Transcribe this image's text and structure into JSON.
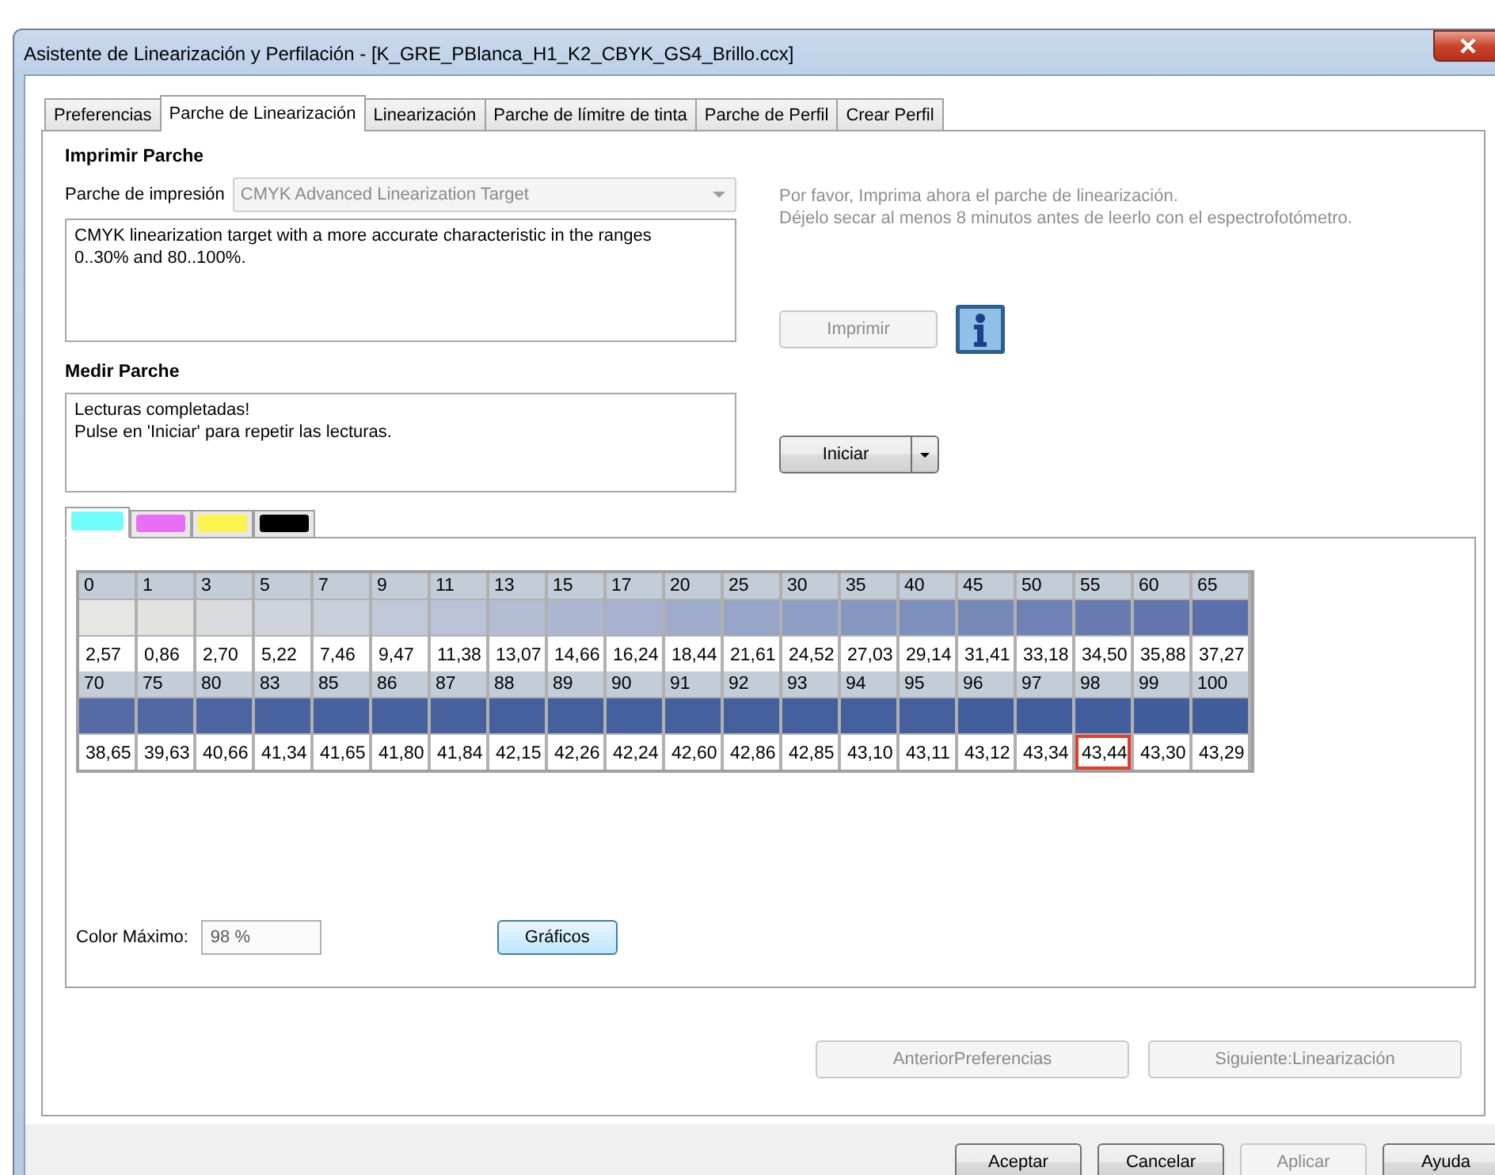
{
  "window": {
    "title": "Asistente de Linearización y Perfilación - [K_GRE_PBlanca_H1_K2_CBYK_GS4_Brillo.ccx]"
  },
  "tabs": [
    {
      "label": "Preferencias",
      "selected": false
    },
    {
      "label": "Parche de Linearización",
      "selected": true
    },
    {
      "label": "Linearización",
      "selected": false
    },
    {
      "label": "Parche de límitre de tinta",
      "selected": false
    },
    {
      "label": "Parche de Perfil",
      "selected": false
    },
    {
      "label": "Crear Perfil",
      "selected": false
    }
  ],
  "print_section": {
    "heading": "Imprimir Parche",
    "target_label": "Parche de impresión",
    "target_value": "CMYK Advanced Linearization Target",
    "target_disabled": true,
    "description": "CMYK linearization target with a more accurate characteristic in the ranges\n0..30% and 80..100%.",
    "instructions": "Por favor, Imprima ahora el parche de linearización.\nDéjelo secar al menos 8 minutos antes de leerlo con el espectrofotómetro.",
    "print_button": {
      "label": "Imprimir",
      "disabled": true
    }
  },
  "measure_section": {
    "heading": "Medir Parche",
    "status": "Lecturas completadas!\nPulse en 'Iniciar' para repetir las lecturas.",
    "start_button": {
      "label": "Iniciar"
    }
  },
  "ink_tabs": [
    {
      "color": "#6ffcfc",
      "selected": true
    },
    {
      "color": "#e76ef5",
      "selected": false
    },
    {
      "color": "#fff34f",
      "selected": false
    },
    {
      "color": "#000000",
      "selected": false
    }
  ],
  "patch_rows": [
    [
      {
        "label": "0",
        "color": "#e6e6e2",
        "value": "2,57",
        "selected": false
      },
      {
        "label": "1",
        "color": "#e2e2df",
        "value": "0,86",
        "selected": false
      },
      {
        "label": "3",
        "color": "#d8dade",
        "value": "2,70",
        "selected": false
      },
      {
        "label": "5",
        "color": "#cfd3dc",
        "value": "5,22",
        "selected": false
      },
      {
        "label": "7",
        "color": "#c8ceda",
        "value": "7,46",
        "selected": false
      },
      {
        "label": "9",
        "color": "#c0c7d8",
        "value": "9,47",
        "selected": false
      },
      {
        "label": "11",
        "color": "#b9c2d6",
        "value": "11,38",
        "selected": false
      },
      {
        "label": "13",
        "color": "#b3bdd4",
        "value": "13,07",
        "selected": false
      },
      {
        "label": "15",
        "color": "#acb7d2",
        "value": "14,66",
        "selected": false
      },
      {
        "label": "17",
        "color": "#a6b2cf",
        "value": "16,24",
        "selected": false
      },
      {
        "label": "20",
        "color": "#9eabcb",
        "value": "18,44",
        "selected": false
      },
      {
        "label": "25",
        "color": "#96a4c8",
        "value": "21,61",
        "selected": false
      },
      {
        "label": "30",
        "color": "#8e9dc4",
        "value": "24,52",
        "selected": false
      },
      {
        "label": "35",
        "color": "#8596c0",
        "value": "27,03",
        "selected": false
      },
      {
        "label": "40",
        "color": "#7d8fbc",
        "value": "29,14",
        "selected": false
      },
      {
        "label": "45",
        "color": "#7688b8",
        "value": "31,41",
        "selected": false
      },
      {
        "label": "50",
        "color": "#6f81b4",
        "value": "33,18",
        "selected": false
      },
      {
        "label": "55",
        "color": "#687bb1",
        "value": "34,50",
        "selected": false
      },
      {
        "label": "60",
        "color": "#6276ad",
        "value": "35,88",
        "selected": false
      },
      {
        "label": "65",
        "color": "#5b70aa",
        "value": "37,27",
        "selected": false
      }
    ],
    [
      {
        "label": "70",
        "color": "#556ba6",
        "value": "38,65",
        "selected": false
      },
      {
        "label": "75",
        "color": "#5068a4",
        "value": "39,63",
        "selected": false
      },
      {
        "label": "80",
        "color": "#4c65a2",
        "value": "40,66",
        "selected": false
      },
      {
        "label": "83",
        "color": "#4963a0",
        "value": "41,34",
        "selected": false
      },
      {
        "label": "85",
        "color": "#48629f",
        "value": "41,65",
        "selected": false
      },
      {
        "label": "86",
        "color": "#47619f",
        "value": "41,80",
        "selected": false
      },
      {
        "label": "87",
        "color": "#47619e",
        "value": "41,84",
        "selected": false
      },
      {
        "label": "88",
        "color": "#46609e",
        "value": "42,15",
        "selected": false
      },
      {
        "label": "89",
        "color": "#46609e",
        "value": "42,26",
        "selected": false
      },
      {
        "label": "90",
        "color": "#45609e",
        "value": "42,24",
        "selected": false
      },
      {
        "label": "91",
        "color": "#45609d",
        "value": "42,60",
        "selected": false
      },
      {
        "label": "92",
        "color": "#455f9d",
        "value": "42,86",
        "selected": false
      },
      {
        "label": "93",
        "color": "#445f9d",
        "value": "42,85",
        "selected": false
      },
      {
        "label": "94",
        "color": "#445f9d",
        "value": "43,10",
        "selected": false
      },
      {
        "label": "95",
        "color": "#445f9c",
        "value": "43,11",
        "selected": false
      },
      {
        "label": "96",
        "color": "#435e9c",
        "value": "43,12",
        "selected": false
      },
      {
        "label": "97",
        "color": "#435e9c",
        "value": "43,34",
        "selected": false
      },
      {
        "label": "98",
        "color": "#435e9c",
        "value": "43,44",
        "selected": true
      },
      {
        "label": "99",
        "color": "#425d9b",
        "value": "43,30",
        "selected": false
      },
      {
        "label": "100",
        "color": "#425d9b",
        "value": "43,29",
        "selected": false
      }
    ]
  ],
  "max_color": {
    "label": "Color Máximo:",
    "value": "98 %"
  },
  "graphs_button": {
    "label": "Gráficos"
  },
  "nav_buttons": [
    {
      "label": "AnteriorPreferencias",
      "disabled": true
    },
    {
      "label": "Siguiente:Linearización",
      "disabled": true
    }
  ],
  "footer_buttons": [
    {
      "label": "Aceptar",
      "disabled": false
    },
    {
      "label": "Cancelar",
      "disabled": false
    },
    {
      "label": "Aplicar",
      "disabled": true
    },
    {
      "label": "Ayuda",
      "disabled": false
    }
  ]
}
